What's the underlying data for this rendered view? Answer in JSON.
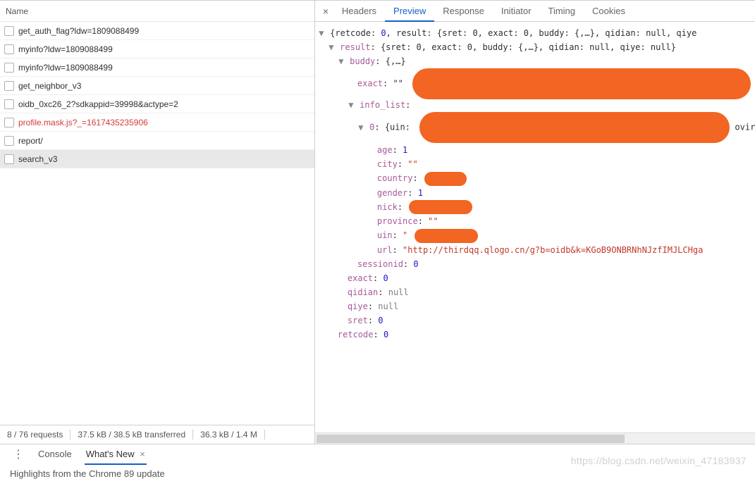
{
  "leftPane": {
    "header": "Name",
    "requests": [
      {
        "text": "get_auth_flag?ldw=1809088499",
        "red": false,
        "selected": false
      },
      {
        "text": "myinfo?ldw=1809088499",
        "red": false,
        "selected": false
      },
      {
        "text": "myinfo?ldw=1809088499",
        "red": false,
        "selected": false
      },
      {
        "text": "get_neighbor_v3",
        "red": false,
        "selected": false
      },
      {
        "text": "oidb_0xc26_2?sdkappid=39998&actype=2",
        "red": false,
        "selected": false
      },
      {
        "text": "profile.mask.js?_=1617435235906",
        "red": true,
        "selected": false
      },
      {
        "text": "report/",
        "red": false,
        "selected": false
      },
      {
        "text": "search_v3",
        "red": false,
        "selected": true
      }
    ],
    "status": {
      "requests": "8 / 76 requests",
      "transferred": "37.5 kB / 38.5 kB transferred",
      "resources": "36.3 kB / 1.4 M"
    }
  },
  "rightPane": {
    "tabs": [
      "Headers",
      "Preview",
      "Response",
      "Initiator",
      "Timing",
      "Cookies"
    ],
    "activeTab": "Preview",
    "close": "×",
    "previewTree": {
      "rootSummary_pre": "{retcode: ",
      "rootSummary_retcode": "0",
      "rootSummary_mid": ", result: {sret: 0, exact: 0, buddy: {,…}, qidian: null, qiye",
      "result_pre": "result",
      "result_summary": ": {sret: 0, exact: 0, buddy: {,…}, qidian: null, qiye: null}",
      "buddy_key": "buddy",
      "buddy_val": ": {,…}",
      "exact1_key": "exact",
      "exact1_val": ": \"\"",
      "infolist_key": "info_list",
      "infolist_val": ":",
      "idx0_key": "0",
      "idx0_val": ": {uin:",
      "idx0_tail": "ovir",
      "age_key": "age",
      "age_val": "1",
      "city_key": "city",
      "city_val": "\"\"",
      "country_key": "country",
      "gender_key": "gender",
      "gender_val": "1",
      "nick_key": "nick",
      "province_key": "province",
      "province_val": "\"\"",
      "uin_key": "uin",
      "uin_valq": "\"",
      "url_key": "url",
      "url_val": "\"http://thirdqq.qlogo.cn/g?b=oidb&k=KGoB9ONBRNhNJzfIMJLCHga",
      "sessionid_key": "sessionid",
      "sessionid_val": "0",
      "exact2_key": "exact",
      "exact2_val": "0",
      "qidian_key": "qidian",
      "qidian_val": "null",
      "qiye_key": "qiye",
      "qiye_val": "null",
      "sret_key": "sret",
      "sret_val": "0",
      "retcode_key": "retcode",
      "retcode_val": "0"
    }
  },
  "drawer": {
    "tabs": [
      "Console",
      "What's New"
    ],
    "activeTab": "What's New",
    "close": "×",
    "body": "Highlights from the Chrome 89 update"
  },
  "watermark": "https://blog.csdn.net/weixin_47183937"
}
